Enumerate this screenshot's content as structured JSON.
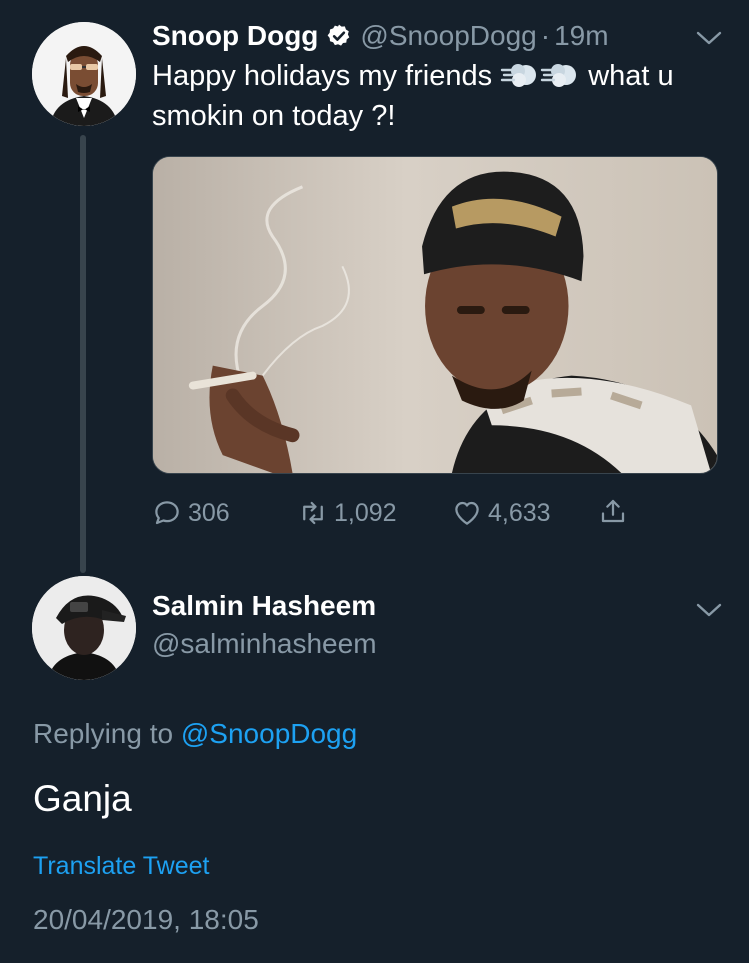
{
  "tweet": {
    "author_name": "Snoop Dogg",
    "handle": "@SnoopDogg",
    "separator": "·",
    "time": "19m",
    "text_before": "Happy holidays my friends",
    "text_after": "what u",
    "text_line2": "smokin on today ?!",
    "emoji": [
      "dashing-away-emoji",
      "dashing-away-emoji"
    ],
    "counts": {
      "replies": "306",
      "retweets": "1,092",
      "likes": "4,633"
    }
  },
  "reply": {
    "author_name": "Salmin Hasheem",
    "handle": "@salminhasheem",
    "replying_prefix": "Replying to ",
    "replying_to": "@SnoopDogg",
    "text": "Ganja",
    "translate_label": "Translate Tweet",
    "timestamp": "20/04/2019, 18:05"
  },
  "colors": {
    "background": "#15202b",
    "secondary_text": "#8899a6",
    "accent": "#1da1f2",
    "primary_text": "#ffffff"
  }
}
